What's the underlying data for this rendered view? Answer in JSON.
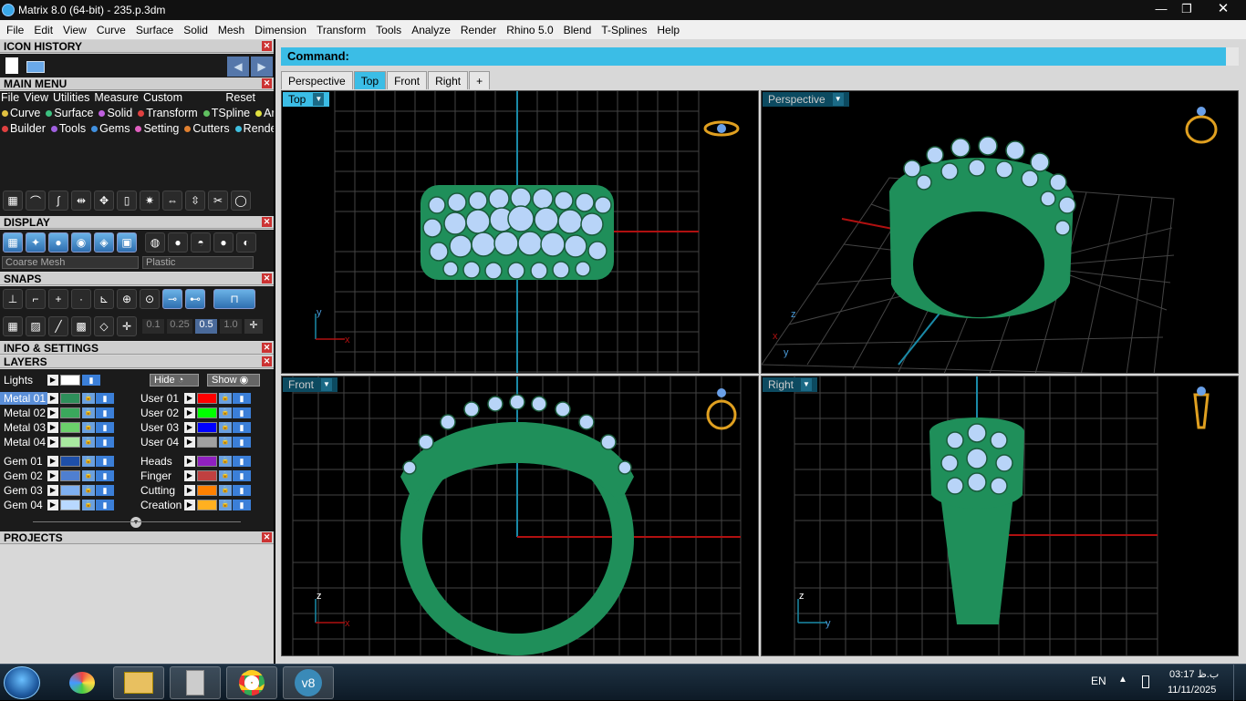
{
  "window": {
    "title": "Matrix 8.0 (64-bit) - 235.p.3dm"
  },
  "menubar": [
    "File",
    "Edit",
    "View",
    "Curve",
    "Surface",
    "Solid",
    "Mesh",
    "Dimension",
    "Transform",
    "Tools",
    "Analyze",
    "Render",
    "Rhino 5.0",
    "Blend",
    "T-Splines",
    "Help"
  ],
  "panels": {
    "icon_history": "ICON HISTORY",
    "main_menu": "MAIN MENU",
    "display": "DISPLAY",
    "snaps": "SNAPS",
    "info_settings": "INFO & SETTINGS",
    "layers": "LAYERS",
    "projects": "PROJECTS"
  },
  "main_menu": {
    "items": [
      "File",
      "View",
      "Utilities",
      "Measure",
      "Custom"
    ],
    "reset": "Reset",
    "row1": [
      {
        "label": "Curve",
        "color": "#e0c040"
      },
      {
        "label": "Surface",
        "color": "#3cc080"
      },
      {
        "label": "Solid",
        "color": "#c060e0"
      },
      {
        "label": "Transform",
        "color": "#e04040"
      },
      {
        "label": "TSpline",
        "color": "#60c060"
      },
      {
        "label": "Art",
        "color": "#e0e040"
      }
    ],
    "row2": [
      {
        "label": "Builder",
        "color": "#e04040"
      },
      {
        "label": "Tools",
        "color": "#a060e0"
      },
      {
        "label": "Gems",
        "color": "#4090e0"
      },
      {
        "label": "Setting",
        "color": "#e060c0"
      },
      {
        "label": "Cutters",
        "color": "#e08030"
      },
      {
        "label": "Render",
        "color": "#40c0e0"
      }
    ]
  },
  "display": {
    "mesh_option": "Coarse Mesh",
    "material_option": "Plastic"
  },
  "snaps": {
    "values": [
      "0.1",
      "0.25",
      "0.5",
      "1.0"
    ],
    "selected": "0.5"
  },
  "layers": {
    "lights": "Lights",
    "hide": "Hide",
    "show": "Show",
    "left": [
      {
        "name": "Metal 01",
        "color": "#2e8f5a",
        "selected": true
      },
      {
        "name": "Metal 02",
        "color": "#3aa85c"
      },
      {
        "name": "Metal 03",
        "color": "#6bd06b"
      },
      {
        "name": "Metal 04",
        "color": "#a8e8a0"
      },
      {
        "name": "Gem 01",
        "color": "#1e4fa8"
      },
      {
        "name": "Gem 02",
        "color": "#4f7fd0"
      },
      {
        "name": "Gem 03",
        "color": "#7fb0f0"
      },
      {
        "name": "Gem 04",
        "color": "#b8d8ff"
      }
    ],
    "right": [
      {
        "name": "User 01",
        "color": "#ff0000"
      },
      {
        "name": "User 02",
        "color": "#00ff00"
      },
      {
        "name": "User 03",
        "color": "#0000ff"
      },
      {
        "name": "User 04",
        "color": "#a0a0a0"
      },
      {
        "name": "Heads",
        "color": "#9020c0"
      },
      {
        "name": "Finger",
        "color": "#c04040"
      },
      {
        "name": "Cutting",
        "color": "#ff8000"
      },
      {
        "name": "Creation",
        "color": "#ffb020"
      }
    ]
  },
  "command": {
    "label": "Command:"
  },
  "tabs": [
    {
      "label": "Perspective"
    },
    {
      "label": "Top",
      "active": true
    },
    {
      "label": "Front"
    },
    {
      "label": "Right"
    },
    {
      "label": "+"
    }
  ],
  "viewports": {
    "top": "Top",
    "perspective": "Perspective",
    "front": "Front",
    "right": "Right"
  },
  "axes": {
    "x": "x",
    "y": "y",
    "z": "z"
  },
  "taskbar": {
    "language": "EN",
    "time": "03:17 ب.ظ",
    "date": "11/11/2025",
    "matrix_icon": "v8"
  },
  "colors": {
    "accent": "#3bbde6",
    "ring": "#1f8f5a",
    "gem": "#b8d4f8",
    "grid": "#4a4a4a"
  }
}
